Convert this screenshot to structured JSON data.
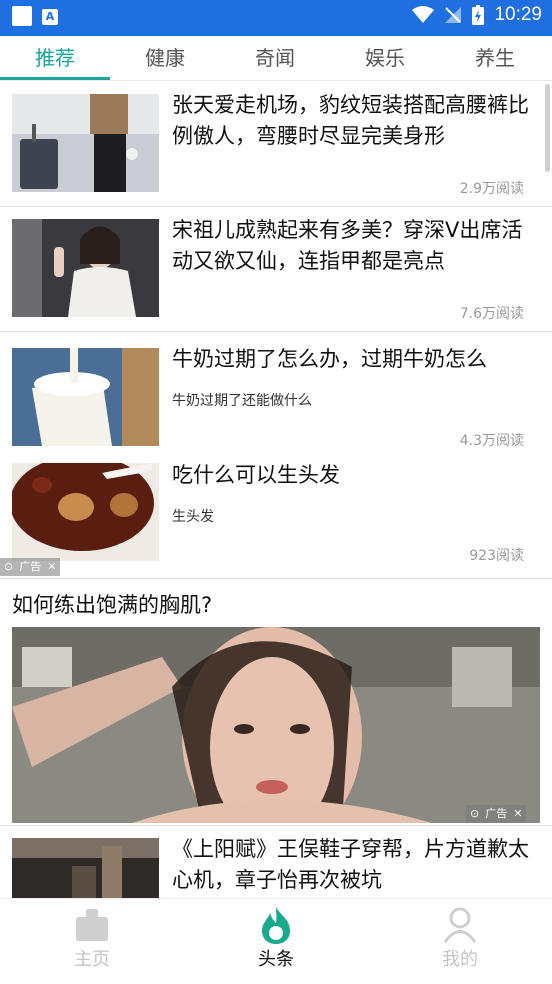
{
  "status_bar": {
    "time": "10:29"
  },
  "tabs": [
    {
      "label": "推荐",
      "active": true
    },
    {
      "label": "健康",
      "active": false
    },
    {
      "label": "奇闻",
      "active": false
    },
    {
      "label": "娱乐",
      "active": false
    },
    {
      "label": "养生",
      "active": false
    }
  ],
  "feed": {
    "items": [
      {
        "title": "张天爱走机场，豹纹短装搭配高腰裤比例傲人，弯腰时尽显完美身形",
        "reads": "2.9万阅读"
      },
      {
        "title": "宋祖儿成熟起来有多美？穿深V出席活动又欲又仙，连指甲都是亮点",
        "reads": "7.6万阅读"
      },
      {
        "title": "牛奶过期了怎么办，过期牛奶怎么",
        "subtitle": "牛奶过期了还能做什么",
        "reads": "4.3万阅读"
      },
      {
        "title": "吃什么可以生头发",
        "subtitle": "生头发",
        "reads": "923阅读"
      }
    ],
    "ad_label": "广告",
    "big_item": {
      "title": "如何练出饱满的胸肌?"
    },
    "last_item": {
      "title": "《上阳赋》王俣鞋子穿帮，片方道歉太心机，章子怡再次被坑"
    }
  },
  "bottom_nav": [
    {
      "label": "主页",
      "icon": "home-icon",
      "active": false
    },
    {
      "label": "头条",
      "icon": "flame-icon",
      "active": true
    },
    {
      "label": "我的",
      "icon": "user-icon",
      "active": false
    }
  ],
  "colors": {
    "status_bar": "#1f6fe0",
    "accent": "#1aa59a"
  }
}
